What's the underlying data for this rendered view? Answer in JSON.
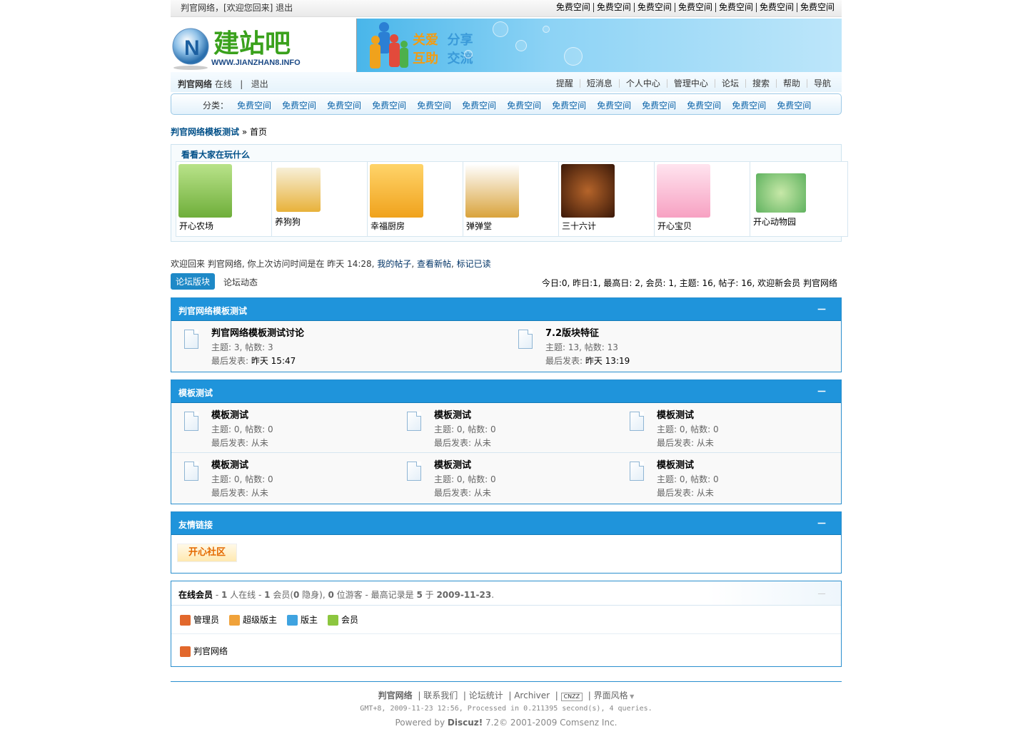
{
  "topbar": {
    "user_text": "判官网络，[欢迎您回来] 退出",
    "links": [
      "免费空间",
      "免费空间",
      "免费空间",
      "免费空间",
      "免费空间",
      "免费空间",
      "免费空间"
    ]
  },
  "logo": {
    "name": "建站吧",
    "url": "WWW.JIANZHAN8.INFO"
  },
  "banner": {
    "line1a": "关爱",
    "line1b": "分享",
    "line2a": "互助",
    "line2b": "交流"
  },
  "usernav": {
    "username": "判官网络",
    "status": "在线",
    "logout": "退出",
    "links": [
      "提醒",
      "短消息",
      "个人中心",
      "管理中心",
      "论坛",
      "搜索",
      "帮助",
      "导航"
    ]
  },
  "catbar": {
    "label": "分类：",
    "items": [
      "免费空间",
      "免费空间",
      "免费空间",
      "免费空间",
      "免费空间",
      "免费空间",
      "免费空间",
      "免费空间",
      "免费空间",
      "免费空间",
      "免费空间",
      "免费空间",
      "免费空间"
    ]
  },
  "breadcrumb": {
    "site": "判官网络模板测试",
    "sep": "»",
    "current": "首页"
  },
  "games": {
    "title": "看看大家在玩什么",
    "items": [
      {
        "name": "开心农场",
        "color": "#6fae3a"
      },
      {
        "name": "养狗狗",
        "color": "#e8b23a"
      },
      {
        "name": "幸福厨房",
        "color": "#f0a21c"
      },
      {
        "name": "弹弹堂",
        "color": "#d9a33c"
      },
      {
        "name": "三十六计",
        "color": "#5a2a10"
      },
      {
        "name": "开心宝贝",
        "color": "#f7a1c2"
      },
      {
        "name": "开心动物园",
        "color": "#5fb25f"
      }
    ]
  },
  "welcome": {
    "text": "欢迎回来 判官网络, 你上次访问时间是在 昨天 14:28,",
    "links": [
      "我的帖子",
      "查看新帖",
      "标记已读"
    ]
  },
  "tabs": {
    "active": "论坛版块",
    "inactive": "论坛动态"
  },
  "stats": "今日:0, 昨日:1, 最高日: 2, 会员: 1, 主题: 16, 帖子: 16, 欢迎新会员 判官网络",
  "cat1": {
    "title": "判官网络模板测试",
    "collapse": "－",
    "forums": [
      {
        "name": "判官网络模板测试讨论",
        "counts": "主题: 3, 帖数: 3",
        "last_label": "最后发表: ",
        "last": "昨天 15:47"
      },
      {
        "name": "7.2版块特征",
        "counts": "主题: 13, 帖数: 13",
        "last_label": "最后发表: ",
        "last": "昨天 13:19"
      }
    ]
  },
  "cat2": {
    "title": "模板测试",
    "collapse": "－",
    "forums": [
      {
        "name": "模板测试",
        "counts": "主题: 0, 帖数: 0",
        "last": "最后发表: 从未"
      },
      {
        "name": "模板测试",
        "counts": "主题: 0, 帖数: 0",
        "last": "最后发表: 从未"
      },
      {
        "name": "模板测试",
        "counts": "主题: 0, 帖数: 0",
        "last": "最后发表: 从未"
      },
      {
        "name": "模板测试",
        "counts": "主题: 0, 帖数: 0",
        "last": "最后发表: 从未"
      },
      {
        "name": "模板测试",
        "counts": "主题: 0, 帖数: 0",
        "last": "最后发表: 从未"
      },
      {
        "name": "模板测试",
        "counts": "主题: 0, 帖数: 0",
        "last": "最后发表: 从未"
      }
    ]
  },
  "links_box": {
    "title": "友情链接",
    "collapse": "－",
    "logo_text": "开心社区"
  },
  "online": {
    "title": "在线会员",
    "summary_html_parts": [
      "- ",
      "1",
      " 人在线 - ",
      "1",
      " 会员(",
      "0",
      " 隐身), ",
      "0",
      " 位游客 - 最高记录是 ",
      "5",
      " 于 ",
      "2009-11-23",
      "."
    ],
    "collapse": "－",
    "legend": [
      {
        "label": "管理员",
        "color": "#e2682c"
      },
      {
        "label": "超级版主",
        "color": "#f0a23a"
      },
      {
        "label": "版主",
        "color": "#3fa3e0"
      },
      {
        "label": "会员",
        "color": "#8cc63f"
      }
    ],
    "members": [
      "判官网络"
    ]
  },
  "footer": {
    "site": "判官网络",
    "links": [
      "联系我们",
      "论坛统计",
      "Archiver"
    ],
    "cnzz": "CNZZ",
    "style": "界面风格",
    "meta": "GMT+8, 2009-11-23 12:56, Processed in 0.211395 second(s), 4 queries.",
    "powered_prefix": "Powered by ",
    "powered_name": "Discuz!",
    "powered_suffix": " 7.2© 2001-2009 Comsenz Inc."
  }
}
